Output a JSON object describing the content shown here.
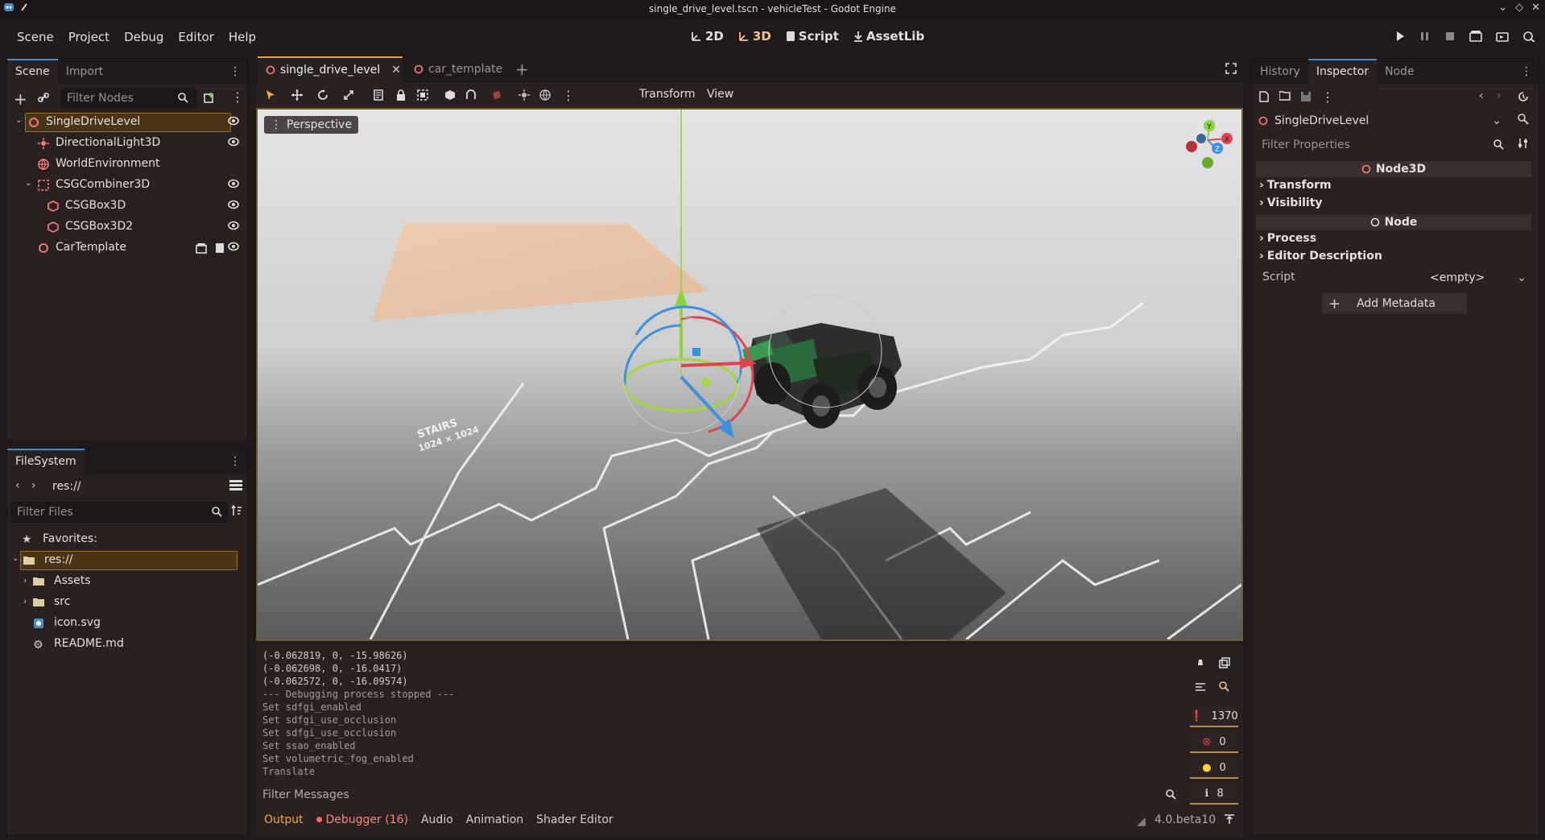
{
  "window": {
    "title": "single_drive_level.tscn - vehicleTest - Godot Engine"
  },
  "menu": {
    "items": [
      "Scene",
      "Project",
      "Debug",
      "Editor",
      "Help"
    ]
  },
  "workspaces": {
    "w2d": "2D",
    "w3d": "3D",
    "script": "Script",
    "assetlib": "AssetLib"
  },
  "scene_dock": {
    "tabs": [
      "Scene",
      "Import"
    ],
    "filter_placeholder": "Filter Nodes",
    "nodes": [
      {
        "label": "SingleDriveLevel",
        "icon": "node3d-icon"
      },
      {
        "label": "DirectionalLight3D",
        "icon": "light-icon"
      },
      {
        "label": "WorldEnvironment",
        "icon": "globe-icon"
      },
      {
        "label": "CSGCombiner3D",
        "icon": "csg-combiner-icon"
      },
      {
        "label": "CSGBox3D",
        "icon": "csg-box-icon"
      },
      {
        "label": "CSGBox3D2",
        "icon": "csg-box-icon"
      },
      {
        "label": "CarTemplate",
        "icon": "node3d-icon"
      }
    ]
  },
  "filesystem": {
    "tab": "FileSystem",
    "path": "res://",
    "filter_placeholder": "Filter Files",
    "items": [
      {
        "label": "Favorites:"
      },
      {
        "label": "res://"
      },
      {
        "label": "Assets"
      },
      {
        "label": "src"
      },
      {
        "label": "icon.svg"
      },
      {
        "label": "README.md"
      }
    ]
  },
  "editor_tabs": {
    "tabs": [
      "single_drive_level",
      "car_template"
    ]
  },
  "viewport_toolbar": {
    "transform": "Transform",
    "view": "View",
    "perspective": "Perspective"
  },
  "viewport_labels": {
    "stairs": "STAIRS",
    "stairs_size": "1024 × 1024"
  },
  "output": {
    "lines": [
      "(-0.062819, 0, -15.98626)",
      "(-0.062698, 0, -16.0417)",
      "(-0.062572, 0, -16.09574)",
      "--- Debugging process stopped ---",
      "Set sdfgi_enabled",
      "Set sdfgi_use_occlusion",
      "Set sdfgi_use_occlusion",
      "Set ssao_enabled",
      "Set volumetric_fog_enabled",
      "Translate"
    ],
    "filter_placeholder": "Filter Messages",
    "counts": {
      "messages": "1370",
      "errors": "0",
      "warnings": "0",
      "info": "8"
    }
  },
  "bottom_tabs": {
    "output": "Output",
    "debugger": "Debugger (16)",
    "audio": "Audio",
    "animation": "Animation",
    "shader": "Shader Editor",
    "version": "4.0.beta10"
  },
  "inspector": {
    "tabs": [
      "History",
      "Inspector",
      "Node"
    ],
    "object": "SingleDriveLevel",
    "filter_placeholder": "Filter Properties",
    "section_node3d": "Node3D",
    "transform": "Transform",
    "visibility": "Visibility",
    "section_node": "Node",
    "process": "Process",
    "editor_description": "Editor Description",
    "script_label": "Script",
    "script_value": "<empty>",
    "add_metadata": "Add Metadata"
  },
  "gizmo_axes": {
    "x": "X",
    "y": "Y",
    "z": "Z"
  },
  "colors": {
    "accent": "#f2a646",
    "selection": "#4a3416",
    "x_axis": "#e0444e",
    "y_axis": "#8bd43c",
    "z_axis": "#3d8fe0"
  }
}
